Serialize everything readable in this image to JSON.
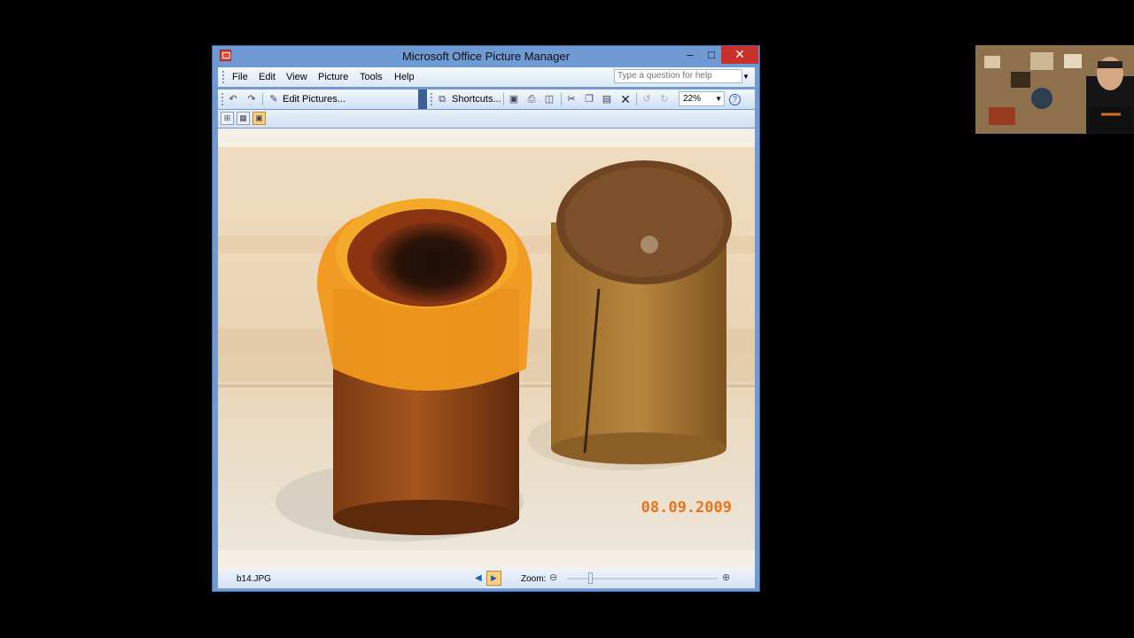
{
  "window": {
    "title": "Microsoft Office Picture Manager",
    "minimize_glyph": "–",
    "maximize_glyph": "□",
    "close_glyph": "✕"
  },
  "menu": {
    "items": [
      "File",
      "Edit",
      "View",
      "Picture",
      "Tools",
      "Help"
    ],
    "help_placeholder": "Type a question for help"
  },
  "toolbar": {
    "edit_pictures_label": "Edit Pictures...",
    "shortcuts_label": "Shortcuts...",
    "zoom_value": "22%"
  },
  "photo": {
    "date_stamp": "08.09.2009"
  },
  "status": {
    "filename": "b14.JPG",
    "zoom_label": "Zoom:"
  },
  "icons": {
    "app": "picture-manager-icon",
    "rotate_left": "rotate-left-icon",
    "rotate_right": "rotate-right-icon",
    "save": "save-icon",
    "print": "print-icon",
    "cut": "cut-icon",
    "delete": "delete-icon",
    "undo": "undo-icon",
    "redo": "redo-icon",
    "help": "help-icon"
  },
  "colors": {
    "title_bar": "#6f9ad3",
    "close_button": "#c9302c",
    "active_view": "#f9cf82",
    "date_stamp": "#e8731c"
  }
}
